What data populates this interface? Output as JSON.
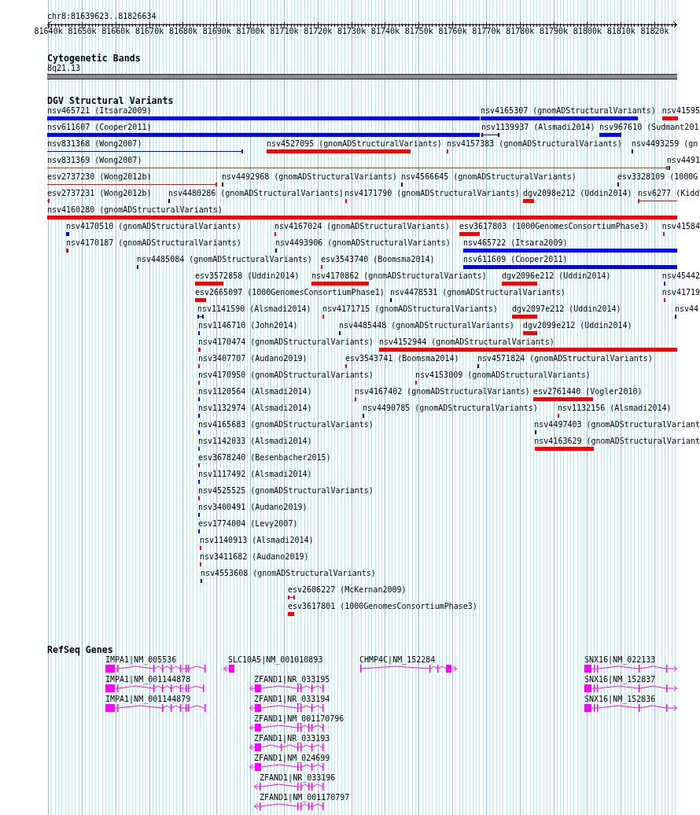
{
  "ruler": {
    "location": "chr8:81639623..81826634",
    "tick_labels": [
      "81640k",
      "81650k",
      "81660k",
      "81670k",
      "81680k",
      "81690k",
      "81700k",
      "81710k",
      "81720k",
      "81730k",
      "81740k",
      "81750k",
      "81760k",
      "81770k",
      "81780k",
      "81790k",
      "81800k",
      "81810k",
      "81820k"
    ]
  },
  "cytogenetic_bands": {
    "title": "Cytogenetic Bands",
    "bands": [
      {
        "label": "8q21.13"
      }
    ]
  },
  "dgv": {
    "title": "DGV Structural Variants",
    "variants": [
      {
        "label": "nsv465721 (Itsara2009)",
        "kind": "bar",
        "color": "#0000ff"
      },
      {
        "label": "nsv4165307 (gnomADStructuralVariants)",
        "kind": "bar",
        "color": "#0000ff"
      },
      {
        "label": "nsv41595",
        "kind": "bar",
        "color": "#ff0000"
      },
      {
        "label": "nsv611607 (Cooper2011)",
        "kind": "bar",
        "color": "#0000ff"
      },
      {
        "label": "nsv1139937 (Alsmadi2014)",
        "kind": "line",
        "color": "#0000ff"
      },
      {
        "label": "nsv967610 (Sudmant201",
        "kind": "bar",
        "color": "#0000ff"
      },
      {
        "label": "nsv831368 (Wong2007)",
        "kind": "line",
        "color": "#0000ff"
      },
      {
        "label": "nsv4527095 (gnomADStructuralVariants)",
        "kind": "bar",
        "color": "#ff0000"
      },
      {
        "label": "nsv4157383 (gnomADStructuralVariants)",
        "kind": "bar",
        "color": "#ff0000"
      },
      {
        "label": "nsv4493259 (gn",
        "kind": "bar",
        "color": "#000000"
      },
      {
        "label": "nsv831369 (Wong2007)",
        "kind": "line",
        "color": "#8b4513"
      },
      {
        "label": "nsv4491",
        "kind": "bar",
        "color": "#000000"
      },
      {
        "label": "esv2737230 (Wong2012b)",
        "kind": "line",
        "color": "#ff0000"
      },
      {
        "label": "nsv4492968 (gnomADStructuralVariants)",
        "kind": "bar",
        "color": "#000000"
      },
      {
        "label": "nsv4566645 (gnomADStructuralVariants)",
        "kind": "bar",
        "color": "#000000"
      },
      {
        "label": "esv3328109 (1000G",
        "kind": "bar",
        "color": "#0000ff"
      },
      {
        "label": "esv2737231 (Wong2012b)",
        "kind": "line",
        "color": "#ff0000"
      },
      {
        "label": "nsv4480286 (gnomADStructuralVariants)",
        "kind": "bar",
        "color": "#000000"
      },
      {
        "label": "nsv4171790 (gnomADStructuralVariants)",
        "kind": "bar",
        "color": "#ff0000"
      },
      {
        "label": "dgv2098e212 (Uddin2014)",
        "kind": "bar",
        "color": "#ff0000"
      },
      {
        "label": "nsv6277 (Kidd",
        "kind": "line",
        "color": "#ff0000"
      },
      {
        "label": "nsv4160280 (gnomADStructuralVariants)",
        "kind": "bar",
        "color": "#ff0000"
      },
      {
        "label": "nsv4170510 (gnomADStructuralVariants)",
        "kind": "bar",
        "color": "#0000ff"
      },
      {
        "label": "nsv4167024 (gnomADStructuralVariants)",
        "kind": "bar",
        "color": "#ff0000"
      },
      {
        "label": "esv3617803 (1000GenomesConsortiumPhase3)",
        "kind": "bar",
        "color": "#ff0000"
      },
      {
        "label": "nsv41584",
        "kind": "bar",
        "color": "#ff0000"
      },
      {
        "label": "nsv4170187 (gnomADStructuralVariants)",
        "kind": "bar",
        "color": "#ff0000"
      },
      {
        "label": "nsv4493906 (gnomADStructuralVariants)",
        "kind": "bar",
        "color": "#000000"
      },
      {
        "label": "nsv465722 (Itsara2009)",
        "kind": "bar",
        "color": "#0000ff"
      },
      {
        "label": "nsv4485084 (gnomADStructuralVariants)",
        "kind": "bar",
        "color": "#000000"
      },
      {
        "label": "esv3543740 (Boomsma2014)",
        "kind": "bar",
        "color": "#ff0000"
      },
      {
        "label": "nsv611609 (Cooper2011)",
        "kind": "bar",
        "color": "#0000ff"
      },
      {
        "label": "esv3572858 (Uddin2014)",
        "kind": "bar",
        "color": "#ff0000"
      },
      {
        "label": "nsv4170862 (gnomADStructuralVariants)",
        "kind": "bar",
        "color": "#ff0000"
      },
      {
        "label": "dgv2096e212 (Uddin2014)",
        "kind": "bar",
        "color": "#ff0000"
      },
      {
        "label": "nsv45442",
        "kind": "bar",
        "color": "#0000ff"
      },
      {
        "label": "esv2665097 (1000GenomesConsortiumPhase1)",
        "kind": "bar",
        "color": "#ff0000"
      },
      {
        "label": "nsv4478531 (gnomADStructuralVariants)",
        "kind": "bar",
        "color": "#000000"
      },
      {
        "label": "nsv41719",
        "kind": "bar",
        "color": "#ff0000"
      },
      {
        "label": "nsv1141590 (Alsmadi2014)",
        "kind": "line",
        "color": "#0000ff"
      },
      {
        "label": "nsv4171715 (gnomADStructuralVariants)",
        "kind": "bar",
        "color": "#ff0000"
      },
      {
        "label": "dgv2097e212 (Uddin2014)",
        "kind": "bar",
        "color": "#ff0000"
      },
      {
        "label": "nsv44",
        "kind": "bar",
        "color": "#000000"
      },
      {
        "label": "nsv1146710 (John2014)",
        "kind": "bar",
        "color": "#0000ff"
      },
      {
        "label": "nsv4485448 (gnomADStructuralVariants)",
        "kind": "bar",
        "color": "#000000"
      },
      {
        "label": "dgv2099e212 (Uddin2014)",
        "kind": "bar",
        "color": "#ff0000"
      },
      {
        "label": "nsv4170474 (gnomADStructuralVariants)",
        "kind": "bar",
        "color": "#ff0000"
      },
      {
        "label": "nsv4152944 (gnomADStructuralVariants)",
        "kind": "bar",
        "color": "#ff0000"
      },
      {
        "label": "nsv3407707 (Audano2019)",
        "kind": "bar",
        "color": "#ff0000"
      },
      {
        "label": "esv3543741 (Boomsma2014)",
        "kind": "bar",
        "color": "#ff0000"
      },
      {
        "label": "nsv4571824 (gnomADStructuralVariants)",
        "kind": "bar",
        "color": "#000000"
      },
      {
        "label": "nsv4170950 (gnomADStructuralVariants)",
        "kind": "bar",
        "color": "#ff0000"
      },
      {
        "label": "nsv4153009 (gnomADStructuralVariants)",
        "kind": "bar",
        "color": "#ff0000"
      },
      {
        "label": "nsv1120564 (Alsmadi2014)",
        "kind": "bar",
        "color": "#0000ff"
      },
      {
        "label": "nsv4167402 (gnomADStructuralVariants)",
        "kind": "bar",
        "color": "#ff0000"
      },
      {
        "label": "esv2761440 (Vogler2010)",
        "kind": "bar",
        "color": "#ff0000"
      },
      {
        "label": "nsv1132974 (Alsmadi2014)",
        "kind": "bar",
        "color": "#0000ff"
      },
      {
        "label": "nsv4490785 (gnomADStructuralVariants)",
        "kind": "bar",
        "color": "#000000"
      },
      {
        "label": "nsv1132156 (Alsmadi2014)",
        "kind": "bar",
        "color": "#ff0000"
      },
      {
        "label": "nsv4165683 (gnomADStructuralVariants)",
        "kind": "bar",
        "color": "#0000ff"
      },
      {
        "label": "nsv4497403 (gnomADStructuralVariant",
        "kind": "bar",
        "color": "#000000"
      },
      {
        "label": "nsv1142033 (Alsmadi2014)",
        "kind": "bar",
        "color": "#4b2e83"
      },
      {
        "label": "nsv4163629 (gnomADStructuralVariant",
        "kind": "bar",
        "color": "#ff0000"
      },
      {
        "label": "esv3678240 (Besenbacher2015)",
        "kind": "bar",
        "color": "#ff0000"
      },
      {
        "label": "nsv1117492 (Alsmadi2014)",
        "kind": "bar",
        "color": "#0000ff"
      },
      {
        "label": "nsv4525525 (gnomADStructuralVariants)",
        "kind": "bar",
        "color": "#ff0000"
      },
      {
        "label": "nsv3400491 (Audano2019)",
        "kind": "bar",
        "color": "#0000ff"
      },
      {
        "label": "esv1774004 (Levy2007)",
        "kind": "bar",
        "color": "#0000ff"
      },
      {
        "label": "nsv1140913 (Alsmadi2014)",
        "kind": "bar",
        "color": "#ff0000"
      },
      {
        "label": "nsv3411682 (Audano2019)",
        "kind": "bar",
        "color": "#ff0000"
      },
      {
        "label": "nsv4553608 (gnomADStructuralVariants)",
        "kind": "bar",
        "color": "#0000ff"
      },
      {
        "label": "esv2606227 (McKernan2009)",
        "kind": "line",
        "color": "#ff0000"
      },
      {
        "label": "esv3617801 (1000GenomesConsortiumPhase3)",
        "kind": "bar",
        "color": "#ff0000"
      }
    ]
  },
  "refseq_genes": {
    "title": "RefSeq Genes",
    "genes": [
      {
        "label": "IMPA1|NM_005536",
        "left_arrow": false,
        "right_arrow": false
      },
      {
        "label": "SLC10A5|NM_001010893",
        "left_arrow": true,
        "right_arrow": false
      },
      {
        "label": "CHMP4C|NM_152284",
        "left_arrow": false,
        "right_arrow": true
      },
      {
        "label": "SNX16|NM_022133",
        "left_arrow": false,
        "right_arrow": true
      },
      {
        "label": "IMPA1|NM_001144878",
        "left_arrow": false,
        "right_arrow": false
      },
      {
        "label": "ZFAND1|NR_033195",
        "left_arrow": true,
        "right_arrow": false
      },
      {
        "label": "SNX16|NM_152837",
        "left_arrow": false,
        "right_arrow": true
      },
      {
        "label": "IMPA1|NM_001144879",
        "left_arrow": false,
        "right_arrow": false
      },
      {
        "label": "ZFAND1|NR_033194",
        "left_arrow": true,
        "right_arrow": false
      },
      {
        "label": "SNX16|NM_152836",
        "left_arrow": false,
        "right_arrow": true
      },
      {
        "label": "ZFAND1|NM_001170796",
        "left_arrow": true,
        "right_arrow": false
      },
      {
        "label": "ZFAND1|NR_033193",
        "left_arrow": true,
        "right_arrow": false
      },
      {
        "label": "ZFAND1|NM_024699",
        "left_arrow": true,
        "right_arrow": false
      },
      {
        "label": "ZFAND1|NR_033196",
        "left_arrow": true,
        "right_arrow": false
      },
      {
        "label": "ZFAND1|NM_001170797",
        "left_arrow": true,
        "right_arrow": false
      }
    ]
  }
}
